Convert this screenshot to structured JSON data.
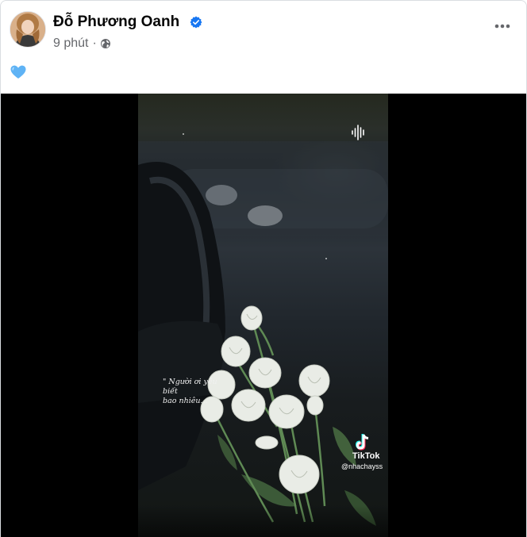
{
  "post": {
    "author_name": "Đỗ Phương Oanh",
    "verified": true,
    "time": "9 phút",
    "separator": "·",
    "audience_icon": "globe-icon",
    "more_icon": "more-options-icon",
    "text": "💙"
  },
  "video": {
    "caption_line1": "\" Người ơi yêu biết",
    "caption_line2": "bao nhiêu...",
    "watermark_brand": "TikTok",
    "watermark_handle": "@nhachayss",
    "colors": {
      "accent": "#1877f2",
      "meta": "#65676b"
    }
  }
}
